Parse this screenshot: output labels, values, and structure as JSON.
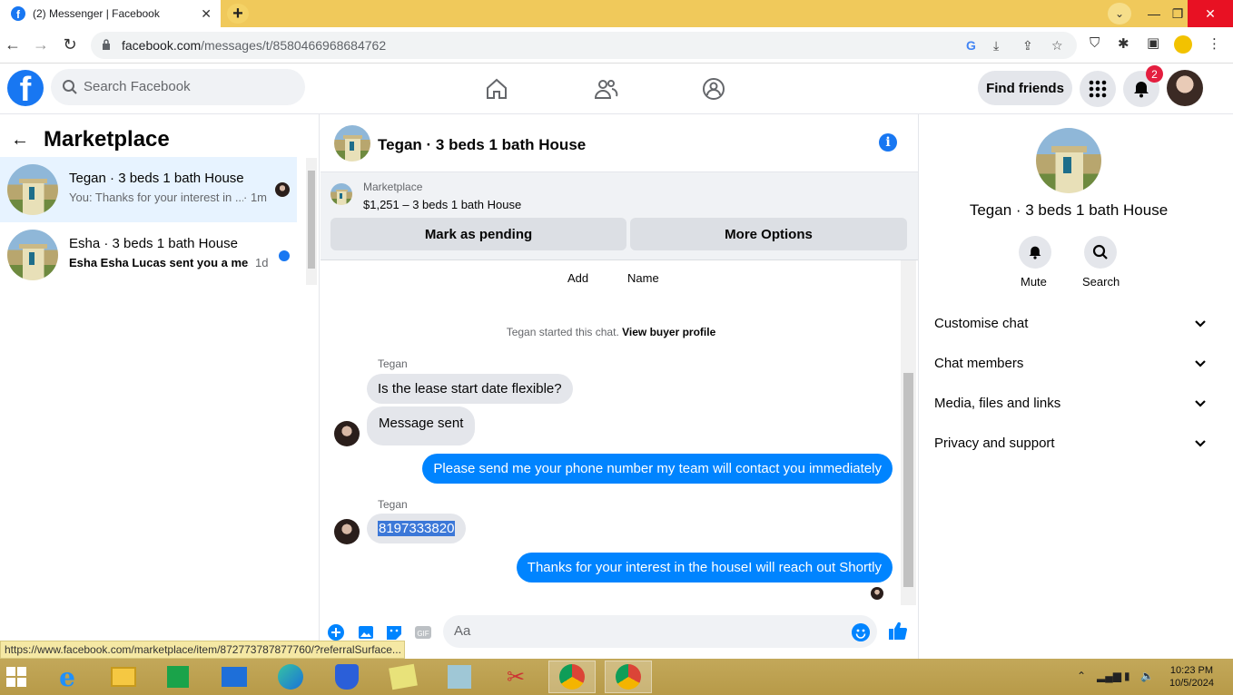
{
  "browser": {
    "tab_title": "(2) Messenger | Facebook",
    "url_host": "facebook.com",
    "url_path": "/messages/t/8580466968684762",
    "status_url": "https://www.facebook.com/marketplace/item/872773787877760/?referralSurface..."
  },
  "fb_header": {
    "search_placeholder": "Search Facebook",
    "find_friends": "Find friends",
    "notification_count": "2"
  },
  "left": {
    "title": "Marketplace",
    "conversations": [
      {
        "name": "Tegan · 3 beds 1 bath House",
        "snippet": "You: Thanks for your interest in ...",
        "time": "· 1m",
        "active": true
      },
      {
        "name": "Esha · 3 beds 1 bath House",
        "snippet": "Esha Esha Lucas sent you a mes...",
        "time": "1d",
        "unread": true
      }
    ]
  },
  "chat": {
    "title": "Tegan · 3 beds 1 bath House",
    "listing_label": "Marketplace",
    "listing_detail": "$1,251 – 3 beds 1 bath House",
    "mark_pending": "Mark as pending",
    "more_options": "More Options",
    "add_label": "Add",
    "name_label": "Name",
    "system_prefix": "Tegan started this chat.",
    "system_link": "View buyer profile",
    "messages": [
      {
        "sender": "Tegan",
        "text": "Is the lease start date flexible?",
        "dir": "in"
      },
      {
        "text": "Message sent",
        "dir": "in"
      },
      {
        "text": "Please send me your phone number my team will contact you immediately",
        "dir": "out"
      },
      {
        "sender": "Tegan",
        "text": "8197333820",
        "dir": "in"
      },
      {
        "text": "Thanks for your interest in the houseI will reach out Shortly",
        "dir": "out"
      }
    ],
    "composer_placeholder": "Aa"
  },
  "right": {
    "name": "Tegan · 3 beds 1 bath House",
    "mute": "Mute",
    "search": "Search",
    "sections": [
      "Customise chat",
      "Chat members",
      "Media, files and links",
      "Privacy and support"
    ]
  },
  "taskbar": {
    "time": "10:23 PM",
    "date": "10/5/2024"
  },
  "colors": {
    "fb_blue": "#1877f2",
    "messenger_blue": "#0084ff",
    "tab_strip": "#f0c95b"
  }
}
